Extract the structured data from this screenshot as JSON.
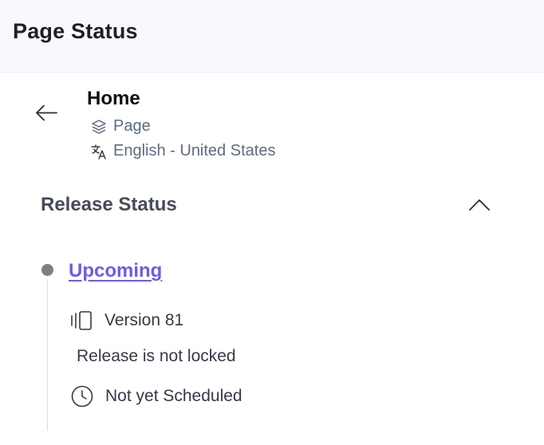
{
  "header": {
    "title": "Page Status"
  },
  "entry": {
    "title": "Home",
    "type_label": "Page",
    "locale_label": "English - United States"
  },
  "release_section": {
    "title": "Release Status",
    "status_link": "Upcoming",
    "version_label": "Version 81",
    "lock_status": "Release is not locked",
    "schedule_status": "Not yet Scheduled"
  },
  "icons": {
    "back": "arrow-left-icon",
    "type": "layers-icon",
    "locale": "translate-icon",
    "collapse": "chevron-up-icon",
    "version": "version-icon",
    "schedule": "clock-icon"
  },
  "colors": {
    "link": "#6c5ce7",
    "meta": "#5d6b82",
    "header_bg": "#f7f9fc",
    "timeline_dot": "#7f8083"
  }
}
